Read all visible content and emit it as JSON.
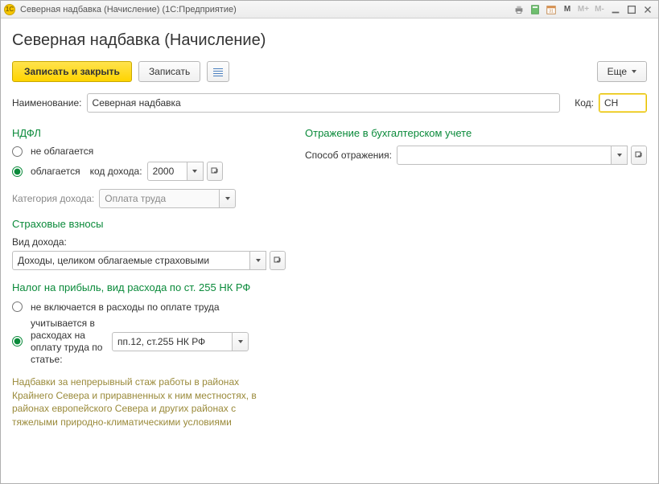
{
  "window": {
    "title": "Северная надбавка (Начисление)  (1С:Предприятие)",
    "logo_text": "1С"
  },
  "header": {
    "title": "Северная надбавка (Начисление)"
  },
  "toolbar": {
    "save_close": "Записать и закрыть",
    "save": "Записать",
    "more": "Еще"
  },
  "fields": {
    "name_label": "Наименование:",
    "name_value": "Северная надбавка",
    "code_label": "Код:",
    "code_value": "СН"
  },
  "ndfl": {
    "title": "НДФЛ",
    "not_taxed": "не облагается",
    "taxed": "облагается",
    "income_code_label": "код дохода:",
    "income_code_value": "2000",
    "category_label": "Категория дохода:",
    "category_value": "Оплата труда"
  },
  "accounting": {
    "title": "Отражение в бухгалтерском учете",
    "method_label": "Способ отражения:",
    "method_value": ""
  },
  "insurance": {
    "title": "Страховые взносы",
    "income_type_label": "Вид дохода:",
    "income_type_value": "Доходы, целиком облагаемые страховыми"
  },
  "profit_tax": {
    "title": "Налог на прибыль, вид расхода по ст. 255 НК РФ",
    "not_included": "не включается в расходы по оплате труда",
    "included": "учитывается в расходах на оплату труда по статье:",
    "article_value": "пп.12, ст.255 НК РФ"
  },
  "description": "Надбавки за непрерывный стаж работы в районах Крайнего Севера и приравненных к ним местностях, в районах европейского Севера и других районах с тяжелыми природно-климатическими условиями"
}
